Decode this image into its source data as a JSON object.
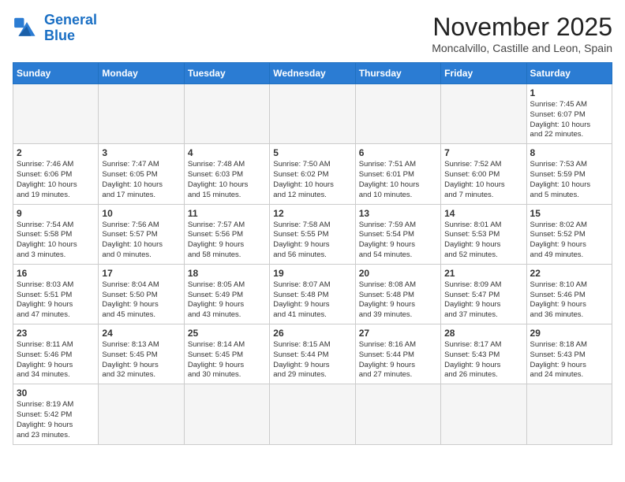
{
  "logo": {
    "line1": "General",
    "line2": "Blue"
  },
  "title": "November 2025",
  "subtitle": "Moncalvillo, Castille and Leon, Spain",
  "days_of_week": [
    "Sunday",
    "Monday",
    "Tuesday",
    "Wednesday",
    "Thursday",
    "Friday",
    "Saturday"
  ],
  "weeks": [
    [
      {
        "day": "",
        "info": ""
      },
      {
        "day": "",
        "info": ""
      },
      {
        "day": "",
        "info": ""
      },
      {
        "day": "",
        "info": ""
      },
      {
        "day": "",
        "info": ""
      },
      {
        "day": "",
        "info": ""
      },
      {
        "day": "1",
        "info": "Sunrise: 7:45 AM\nSunset: 6:07 PM\nDaylight: 10 hours\nand 22 minutes."
      }
    ],
    [
      {
        "day": "2",
        "info": "Sunrise: 7:46 AM\nSunset: 6:06 PM\nDaylight: 10 hours\nand 19 minutes."
      },
      {
        "day": "3",
        "info": "Sunrise: 7:47 AM\nSunset: 6:05 PM\nDaylight: 10 hours\nand 17 minutes."
      },
      {
        "day": "4",
        "info": "Sunrise: 7:48 AM\nSunset: 6:03 PM\nDaylight: 10 hours\nand 15 minutes."
      },
      {
        "day": "5",
        "info": "Sunrise: 7:50 AM\nSunset: 6:02 PM\nDaylight: 10 hours\nand 12 minutes."
      },
      {
        "day": "6",
        "info": "Sunrise: 7:51 AM\nSunset: 6:01 PM\nDaylight: 10 hours\nand 10 minutes."
      },
      {
        "day": "7",
        "info": "Sunrise: 7:52 AM\nSunset: 6:00 PM\nDaylight: 10 hours\nand 7 minutes."
      },
      {
        "day": "8",
        "info": "Sunrise: 7:53 AM\nSunset: 5:59 PM\nDaylight: 10 hours\nand 5 minutes."
      }
    ],
    [
      {
        "day": "9",
        "info": "Sunrise: 7:54 AM\nSunset: 5:58 PM\nDaylight: 10 hours\nand 3 minutes."
      },
      {
        "day": "10",
        "info": "Sunrise: 7:56 AM\nSunset: 5:57 PM\nDaylight: 10 hours\nand 0 minutes."
      },
      {
        "day": "11",
        "info": "Sunrise: 7:57 AM\nSunset: 5:56 PM\nDaylight: 9 hours\nand 58 minutes."
      },
      {
        "day": "12",
        "info": "Sunrise: 7:58 AM\nSunset: 5:55 PM\nDaylight: 9 hours\nand 56 minutes."
      },
      {
        "day": "13",
        "info": "Sunrise: 7:59 AM\nSunset: 5:54 PM\nDaylight: 9 hours\nand 54 minutes."
      },
      {
        "day": "14",
        "info": "Sunrise: 8:01 AM\nSunset: 5:53 PM\nDaylight: 9 hours\nand 52 minutes."
      },
      {
        "day": "15",
        "info": "Sunrise: 8:02 AM\nSunset: 5:52 PM\nDaylight: 9 hours\nand 49 minutes."
      }
    ],
    [
      {
        "day": "16",
        "info": "Sunrise: 8:03 AM\nSunset: 5:51 PM\nDaylight: 9 hours\nand 47 minutes."
      },
      {
        "day": "17",
        "info": "Sunrise: 8:04 AM\nSunset: 5:50 PM\nDaylight: 9 hours\nand 45 minutes."
      },
      {
        "day": "18",
        "info": "Sunrise: 8:05 AM\nSunset: 5:49 PM\nDaylight: 9 hours\nand 43 minutes."
      },
      {
        "day": "19",
        "info": "Sunrise: 8:07 AM\nSunset: 5:48 PM\nDaylight: 9 hours\nand 41 minutes."
      },
      {
        "day": "20",
        "info": "Sunrise: 8:08 AM\nSunset: 5:48 PM\nDaylight: 9 hours\nand 39 minutes."
      },
      {
        "day": "21",
        "info": "Sunrise: 8:09 AM\nSunset: 5:47 PM\nDaylight: 9 hours\nand 37 minutes."
      },
      {
        "day": "22",
        "info": "Sunrise: 8:10 AM\nSunset: 5:46 PM\nDaylight: 9 hours\nand 36 minutes."
      }
    ],
    [
      {
        "day": "23",
        "info": "Sunrise: 8:11 AM\nSunset: 5:46 PM\nDaylight: 9 hours\nand 34 minutes."
      },
      {
        "day": "24",
        "info": "Sunrise: 8:13 AM\nSunset: 5:45 PM\nDaylight: 9 hours\nand 32 minutes."
      },
      {
        "day": "25",
        "info": "Sunrise: 8:14 AM\nSunset: 5:45 PM\nDaylight: 9 hours\nand 30 minutes."
      },
      {
        "day": "26",
        "info": "Sunrise: 8:15 AM\nSunset: 5:44 PM\nDaylight: 9 hours\nand 29 minutes."
      },
      {
        "day": "27",
        "info": "Sunrise: 8:16 AM\nSunset: 5:44 PM\nDaylight: 9 hours\nand 27 minutes."
      },
      {
        "day": "28",
        "info": "Sunrise: 8:17 AM\nSunset: 5:43 PM\nDaylight: 9 hours\nand 26 minutes."
      },
      {
        "day": "29",
        "info": "Sunrise: 8:18 AM\nSunset: 5:43 PM\nDaylight: 9 hours\nand 24 minutes."
      }
    ],
    [
      {
        "day": "30",
        "info": "Sunrise: 8:19 AM\nSunset: 5:42 PM\nDaylight: 9 hours\nand 23 minutes."
      },
      {
        "day": "",
        "info": ""
      },
      {
        "day": "",
        "info": ""
      },
      {
        "day": "",
        "info": ""
      },
      {
        "day": "",
        "info": ""
      },
      {
        "day": "",
        "info": ""
      },
      {
        "day": "",
        "info": ""
      }
    ]
  ]
}
